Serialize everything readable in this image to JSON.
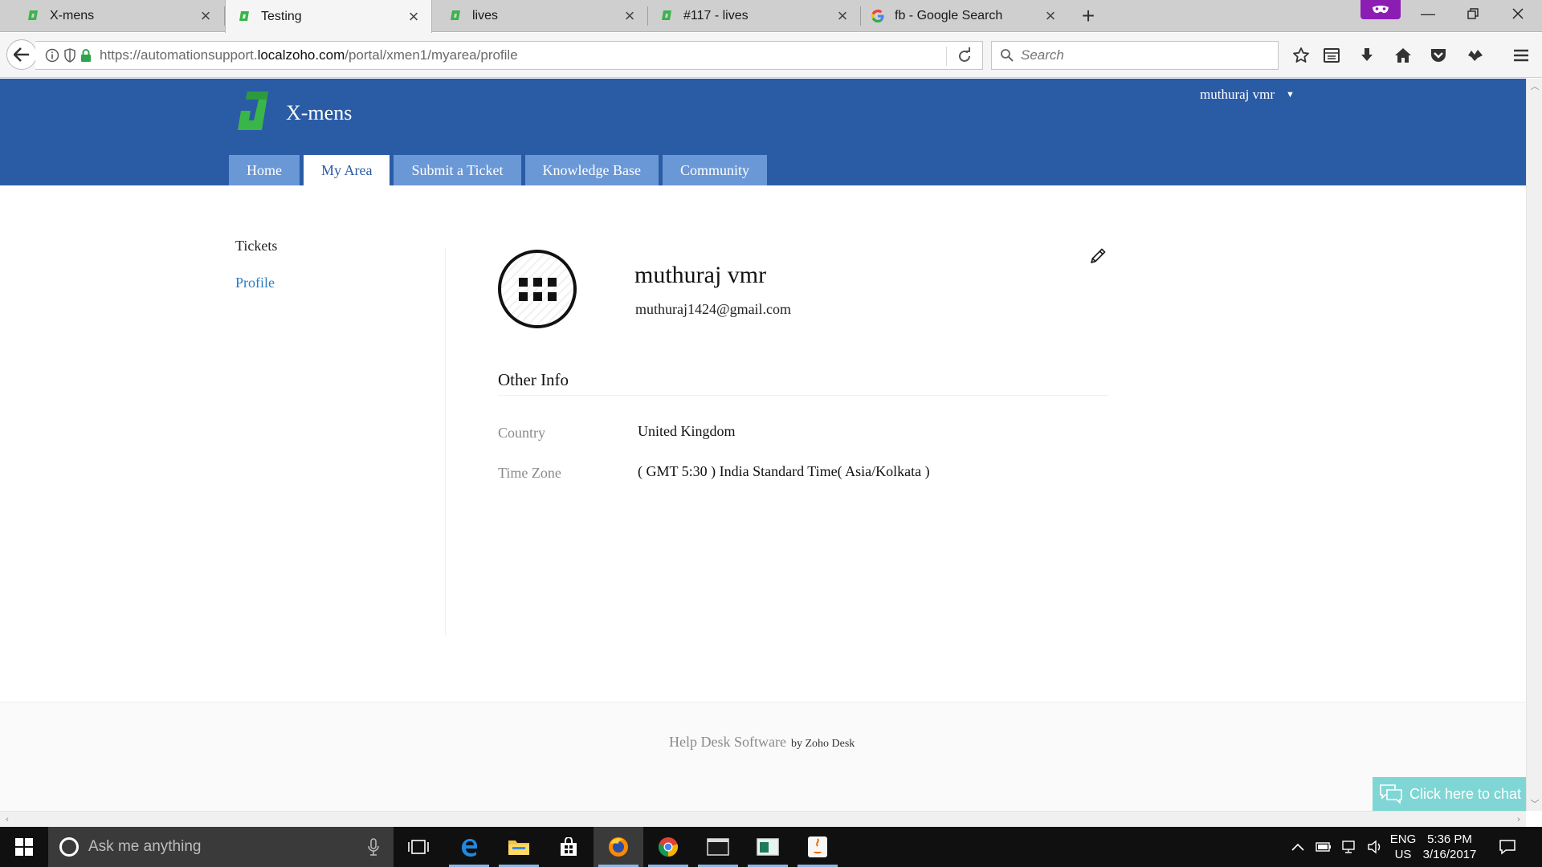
{
  "browser": {
    "tabs": [
      {
        "title": "X-mens",
        "favicon": "zoho-desk-icon",
        "active": false
      },
      {
        "title": "Testing",
        "favicon": "zoho-desk-icon",
        "active": true
      },
      {
        "title": "lives",
        "favicon": "zoho-desk-icon",
        "active": false
      },
      {
        "title": "#117 - lives",
        "favicon": "zoho-desk-icon",
        "active": false
      },
      {
        "title": "fb - Google Search",
        "favicon": "google-icon",
        "active": false
      }
    ],
    "url_prefix": "https://automationsupport.",
    "url_host": "localzoho.com",
    "url_path": "/portal/xmen1/myarea/profile",
    "search_placeholder": "Search"
  },
  "portal": {
    "brand": "X-mens",
    "user_menu": "muthuraj vmr",
    "nav": [
      {
        "label": "Home",
        "active": false
      },
      {
        "label": "My Area",
        "active": true
      },
      {
        "label": "Submit a Ticket",
        "active": false
      },
      {
        "label": "Knowledge Base",
        "active": false
      },
      {
        "label": "Community",
        "active": false
      }
    ],
    "sidebar": [
      {
        "label": "Tickets",
        "active": false
      },
      {
        "label": "Profile",
        "active": true
      }
    ]
  },
  "profile": {
    "name": "muthuraj vmr",
    "email": "muthuraj1424@gmail.com",
    "section_title": "Other Info",
    "fields": [
      {
        "label": "Country",
        "value": "United Kingdom"
      },
      {
        "label": "Time Zone",
        "value": "( GMT 5:30 ) India Standard Time( Asia/Kolkata )"
      }
    ]
  },
  "footer": {
    "text": "Help Desk Software",
    "by": "by Zoho Desk"
  },
  "chat": {
    "label": "Click here to chat"
  },
  "taskbar": {
    "search_placeholder": "Ask me anything",
    "lang_top": "ENG",
    "lang_bottom": "US",
    "time": "5:36 PM",
    "date": "3/16/2017"
  },
  "colors": {
    "portal_header": "#2a5ba5",
    "nav_tab": "#6a97d6",
    "sidebar_active": "#2a7bc4",
    "chat_button": "#7fd6d4",
    "logo_green": "#3ab54a",
    "private_badge": "#8c1db3"
  }
}
